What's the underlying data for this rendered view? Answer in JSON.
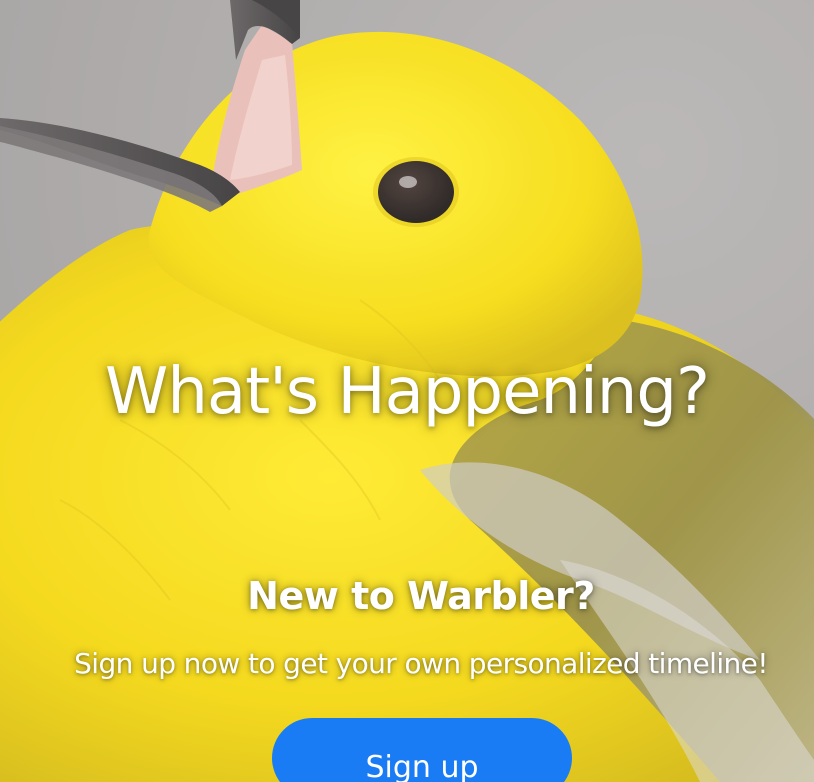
{
  "hero": {
    "image_icon": "yellow-warbler-photo",
    "headline": "What's Happening?",
    "subheadline": "New to Warbler?",
    "tagline": "Sign up now to get your own personalized timeline!",
    "signup_label": "Sign up"
  },
  "colors": {
    "accent": "#1a7cf5",
    "text": "#ffffff",
    "bird_yellow": "#f2d400",
    "background_gray": "#a8a6a6"
  }
}
